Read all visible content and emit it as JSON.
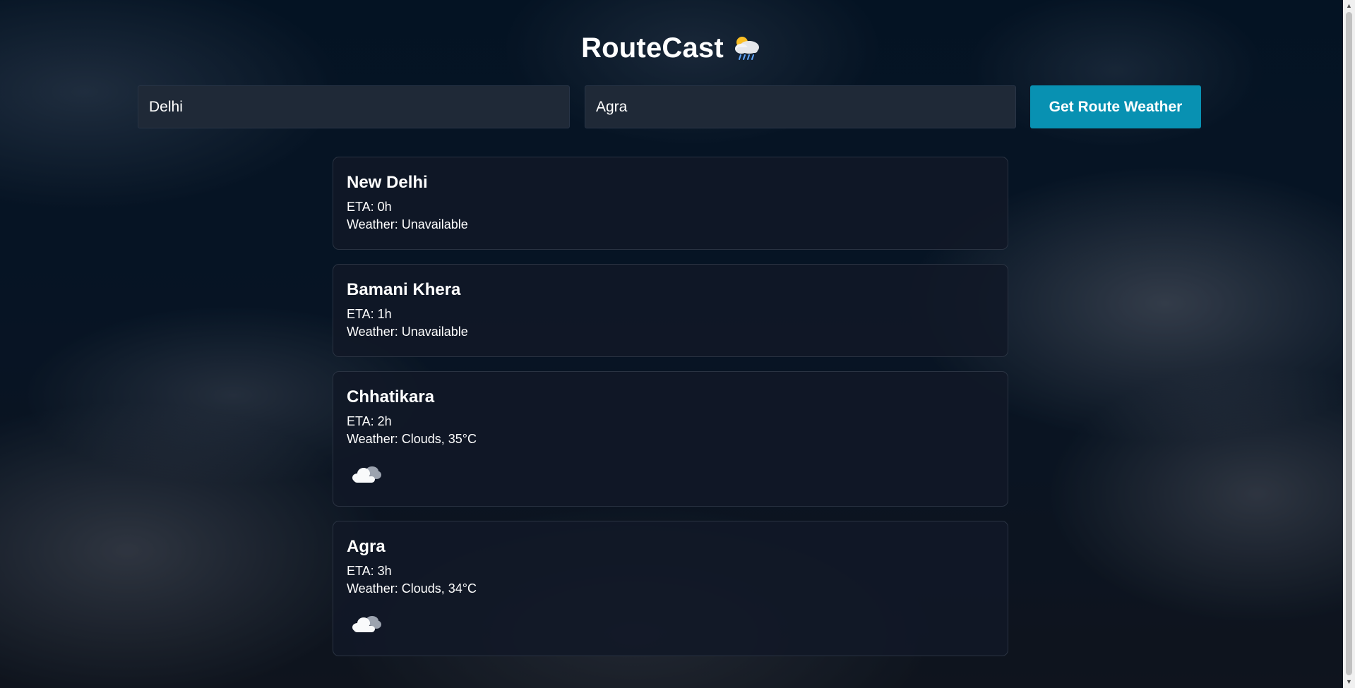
{
  "app": {
    "title": "RouteCast",
    "title_icon": "cloud-rain-sun-icon"
  },
  "search": {
    "from_value": "Delhi",
    "to_value": "Agra",
    "button_label": "Get Route Weather"
  },
  "stops": [
    {
      "name": "New Delhi",
      "eta": "ETA: 0h",
      "weather": "Weather: Unavailable",
      "icon": ""
    },
    {
      "name": "Bamani Khera",
      "eta": "ETA: 1h",
      "weather": "Weather: Unavailable",
      "icon": ""
    },
    {
      "name": "Chhatikara",
      "eta": "ETA: 2h",
      "weather": "Weather: Clouds, 35°C",
      "icon": "clouds-icon"
    },
    {
      "name": "Agra",
      "eta": "ETA: 3h",
      "weather": "Weather: Clouds, 34°C",
      "icon": "clouds-icon"
    }
  ],
  "colors": {
    "accent": "#0891b2",
    "input_bg": "#1f2937",
    "card_bg": "#111827"
  }
}
